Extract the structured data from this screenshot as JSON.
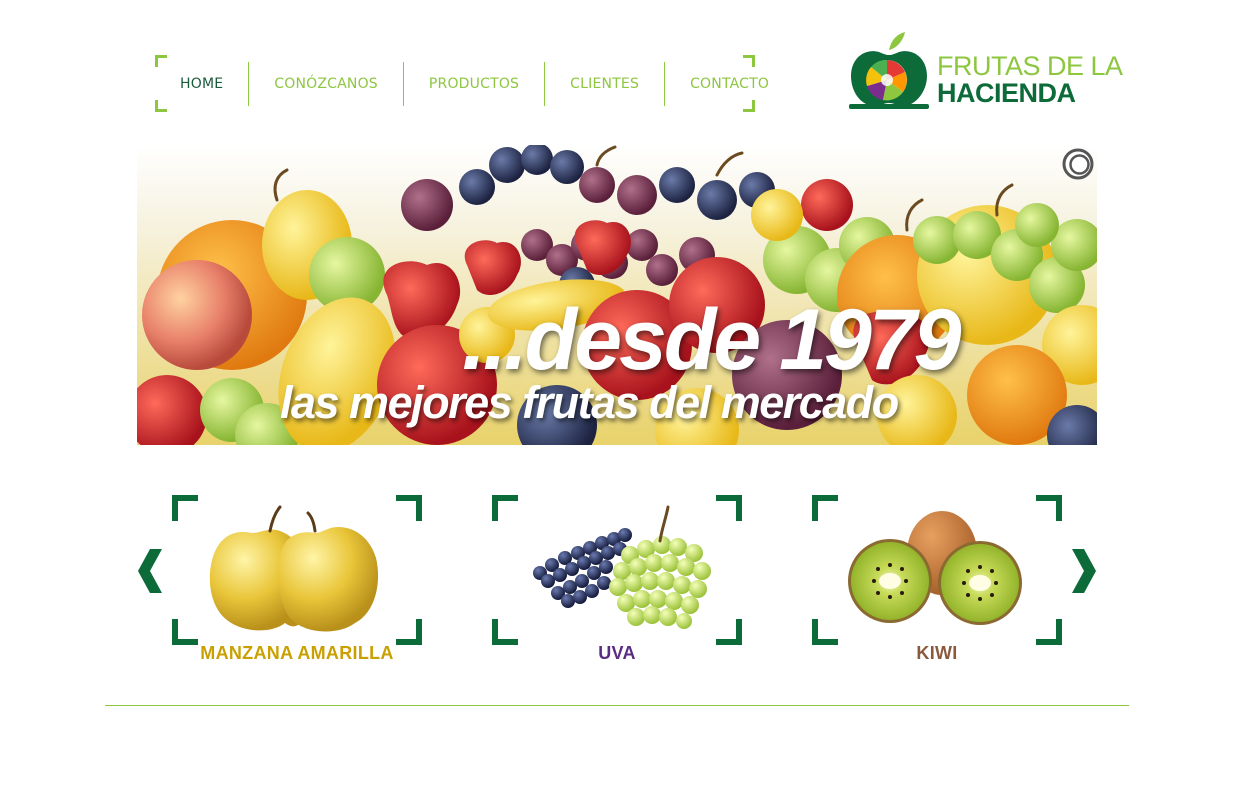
{
  "nav": {
    "items": [
      {
        "label": "HOME",
        "active": true
      },
      {
        "label": "CONÓZCANOS",
        "active": false
      },
      {
        "label": "PRODUCTOS",
        "active": false
      },
      {
        "label": "CLIENTES",
        "active": false
      },
      {
        "label": "CONTACTO",
        "active": false
      }
    ]
  },
  "logo": {
    "line1": "FRUTAS DE LA",
    "line2": "HACIENDA",
    "icon": "apple-logo-icon"
  },
  "banner": {
    "headline": "...desde 1979",
    "subheadline": "las mejores frutas del mercado",
    "control_icon": "slider-pause-icon"
  },
  "products": {
    "prev_icon": "chevron-left-icon",
    "next_icon": "chevron-right-icon",
    "items": [
      {
        "name": "MANZANA AMARILLA",
        "color": "#c9a000"
      },
      {
        "name": "UVA",
        "color": "#5a2d82"
      },
      {
        "name": "KIWI",
        "color": "#8a5a3c"
      }
    ]
  },
  "colors": {
    "accent_light_green": "#8dc63f",
    "accent_dark_green": "#0d6b3a",
    "nav_active": "#1b5a3a"
  }
}
